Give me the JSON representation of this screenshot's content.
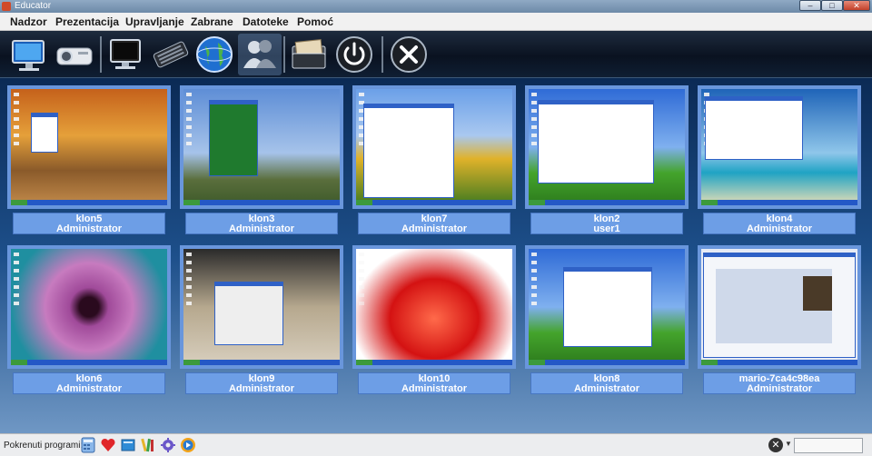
{
  "window": {
    "title": "Educator",
    "controls": [
      "minimize",
      "maximize",
      "close"
    ]
  },
  "menu": [
    "Nadzor",
    "Prezentacija",
    "Upravljanje",
    "Zabrane",
    "Datoteke",
    "Pomoć"
  ],
  "toolbar": {
    "buttons": [
      {
        "icon": "monitor-view-icon"
      },
      {
        "icon": "projector-icon"
      },
      {
        "icon": "screen-lock-icon"
      },
      {
        "icon": "keyboard-lock-icon"
      },
      {
        "icon": "globe-icon"
      },
      {
        "icon": "users-icon",
        "active": true
      },
      {
        "icon": "files-icon"
      },
      {
        "icon": "power-icon"
      },
      {
        "icon": "close-circle-icon"
      }
    ]
  },
  "clients": [
    {
      "name": "klon5",
      "user": "Administrator",
      "scene": "autumn"
    },
    {
      "name": "klon3",
      "user": "Administrator",
      "scene": "stone"
    },
    {
      "name": "klon7",
      "user": "Administrator",
      "scene": "tulip"
    },
    {
      "name": "klon2",
      "user": "user1",
      "scene": "bliss"
    },
    {
      "name": "klon4",
      "user": "Administrator",
      "scene": "beach"
    },
    {
      "name": "klon6",
      "user": "Administrator",
      "scene": "flower"
    },
    {
      "name": "klon9",
      "user": "Administrator",
      "scene": "dark"
    },
    {
      "name": "klon10",
      "user": "Administrator",
      "scene": "red"
    },
    {
      "name": "klon8",
      "user": "Administrator",
      "scene": "bliss"
    },
    {
      "name": "mario-7ca4c98ea",
      "user": "Administrator",
      "scene": "web"
    }
  ],
  "statusbar": {
    "label": "Pokrenuti programi:",
    "programs": [
      "calculator-icon",
      "heart-icon",
      "book-icon",
      "paint-icon",
      "gear-icon",
      "media-player-icon"
    ],
    "close_symbol": "✕"
  }
}
